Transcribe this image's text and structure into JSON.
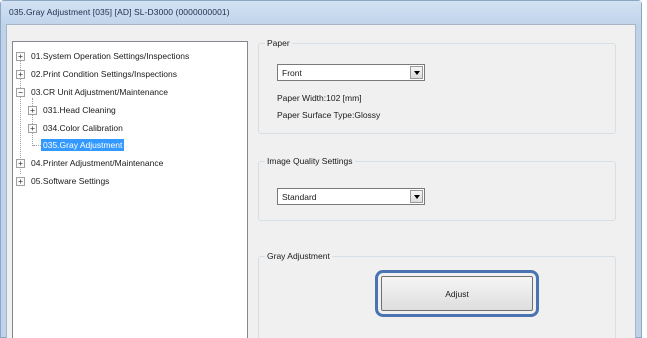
{
  "window": {
    "title": "035.Gray Adjustment  [035]  [AD]  SL-D3000  (0000000001)"
  },
  "tree": {
    "items": [
      {
        "label": "01.System Operation Settings/Inspections",
        "expander": "+"
      },
      {
        "label": "02.Print Condition Settings/Inspections",
        "expander": "+"
      },
      {
        "label": "03.CR Unit Adjustment/Maintenance",
        "expander": "−"
      },
      {
        "label": "031.Head Cleaning",
        "expander": "+"
      },
      {
        "label": "034.Color Calibration",
        "expander": "+"
      },
      {
        "label": "035.Gray Adjustment",
        "selected": true
      },
      {
        "label": "04.Printer Adjustment/Maintenance",
        "expander": "+"
      },
      {
        "label": "05.Software Settings",
        "expander": "+"
      }
    ]
  },
  "paper": {
    "group_title": "Paper",
    "selected_side": "Front",
    "width_text": "Paper Width:102 [mm]",
    "surface_text": "Paper Surface Type:Glossy"
  },
  "image_quality": {
    "group_title": "Image Quality Settings",
    "selected": "Standard"
  },
  "gray_adjustment": {
    "group_title": "Gray Adjustment",
    "adjust_label": "Adjust"
  },
  "colors": {
    "selection": "#3399ff",
    "highlight_ring": "#4a73b2",
    "title_bar": "#bfd4eb"
  },
  "icons": {
    "combo_arrow": "chevron-down-icon",
    "expand": "plus-icon",
    "collapse": "minus-icon"
  }
}
